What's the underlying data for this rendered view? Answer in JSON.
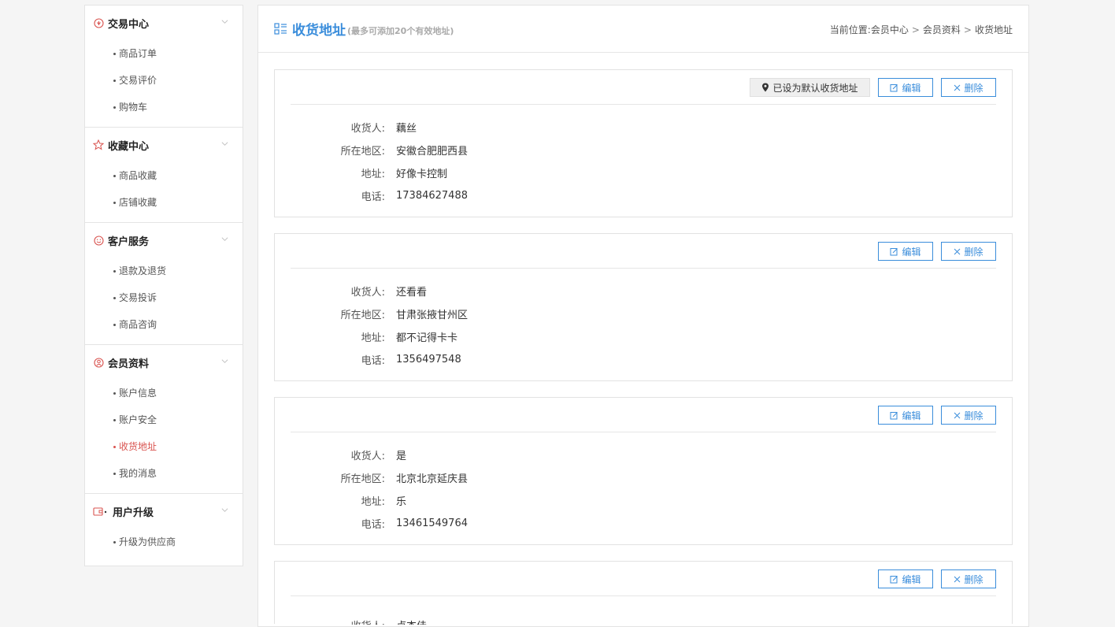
{
  "sidebar": {
    "groups": [
      {
        "title": "交易中心",
        "items": [
          "商品订单",
          "交易评价",
          "购物车"
        ]
      },
      {
        "title": "收藏中心",
        "items": [
          "商品收藏",
          "店铺收藏"
        ]
      },
      {
        "title": "客户服务",
        "items": [
          "退款及退货",
          "交易投诉",
          "商品咨询"
        ]
      },
      {
        "title": "会员资料",
        "items": [
          "账户信息",
          "账户安全",
          "收货地址",
          "我的消息"
        ]
      },
      {
        "title": "用户升级",
        "items": [
          "升级为供应商"
        ]
      }
    ],
    "active_item": "收货地址",
    "accent_color": "#d9534f"
  },
  "header": {
    "title": "收货地址",
    "subtitle": "(最多可添加20个有效地址)",
    "breadcrumb": {
      "prefix": "当前位置:",
      "items": [
        "会员中心",
        "会员资料",
        "收货地址"
      ],
      "separator": ">"
    },
    "title_color": "#3a8ddb"
  },
  "labels": {
    "receiver": "收货人:",
    "region": "所在地区:",
    "address": "地址:",
    "phone": "电话:",
    "edit": "编辑",
    "delete": "删除",
    "default_badge": "已设为默认收货地址"
  },
  "addresses": [
    {
      "receiver": "藕丝",
      "region": "安徽合肥肥西县",
      "address": "好像卡控制",
      "phone": "17384627488",
      "is_default": true
    },
    {
      "receiver": "还看看",
      "region": "甘肃张掖甘州区",
      "address": "都不记得卡卡",
      "phone": "1356497548",
      "is_default": false
    },
    {
      "receiver": "是",
      "region": "北京北京延庆县",
      "address": "乐",
      "phone": "13461549764",
      "is_default": false
    },
    {
      "receiver": "卢杰佳",
      "region": "",
      "address": "",
      "phone": "",
      "is_default": false
    }
  ]
}
